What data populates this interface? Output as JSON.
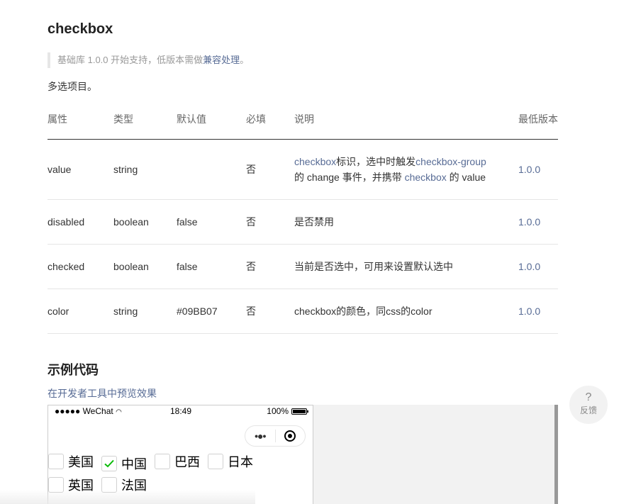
{
  "page": {
    "title": "checkbox",
    "note_prefix": "基础库 1.0.0 开始支持，低版本需做",
    "note_link": "兼容处理",
    "note_suffix": "。",
    "description": "多选项目。"
  },
  "table": {
    "headers": [
      "属性",
      "类型",
      "默认值",
      "必填",
      "说明",
      "最低版本"
    ],
    "rows": [
      {
        "name": "value",
        "type": "string",
        "default": "",
        "required": "否",
        "desc_parts": [
          "checkbox",
          "标识，选中时触发",
          "checkbox-group",
          "的 change 事件，并携带 ",
          "checkbox",
          " 的 value"
        ],
        "version": "1.0.0"
      },
      {
        "name": "disabled",
        "type": "boolean",
        "default": "false",
        "required": "否",
        "desc": "是否禁用",
        "version": "1.0.0"
      },
      {
        "name": "checked",
        "type": "boolean",
        "default": "false",
        "required": "否",
        "desc": "当前是否选中，可用来设置默认选中",
        "version": "1.0.0"
      },
      {
        "name": "color",
        "type": "string",
        "default": "#09BB07",
        "required": "否",
        "desc": "checkbox的颜色，同css的color",
        "version": "1.0.0"
      }
    ]
  },
  "example": {
    "heading": "示例代码",
    "preview_link": "在开发者工具中预览效果"
  },
  "phone": {
    "carrier": "●●●●● WeChat",
    "time": "18:49",
    "battery": "100%",
    "capsule_dots": "•●•",
    "checkboxes": [
      {
        "label": "美国",
        "checked": false
      },
      {
        "label": "中国",
        "checked": true
      },
      {
        "label": "巴西",
        "checked": false
      },
      {
        "label": "日本",
        "checked": false
      },
      {
        "label": "英国",
        "checked": false
      },
      {
        "label": "法国",
        "checked": false
      }
    ]
  },
  "feedback": {
    "icon": "?",
    "label": "反馈"
  },
  "colors": {
    "link": "#576b95",
    "check": "#09BB07"
  }
}
